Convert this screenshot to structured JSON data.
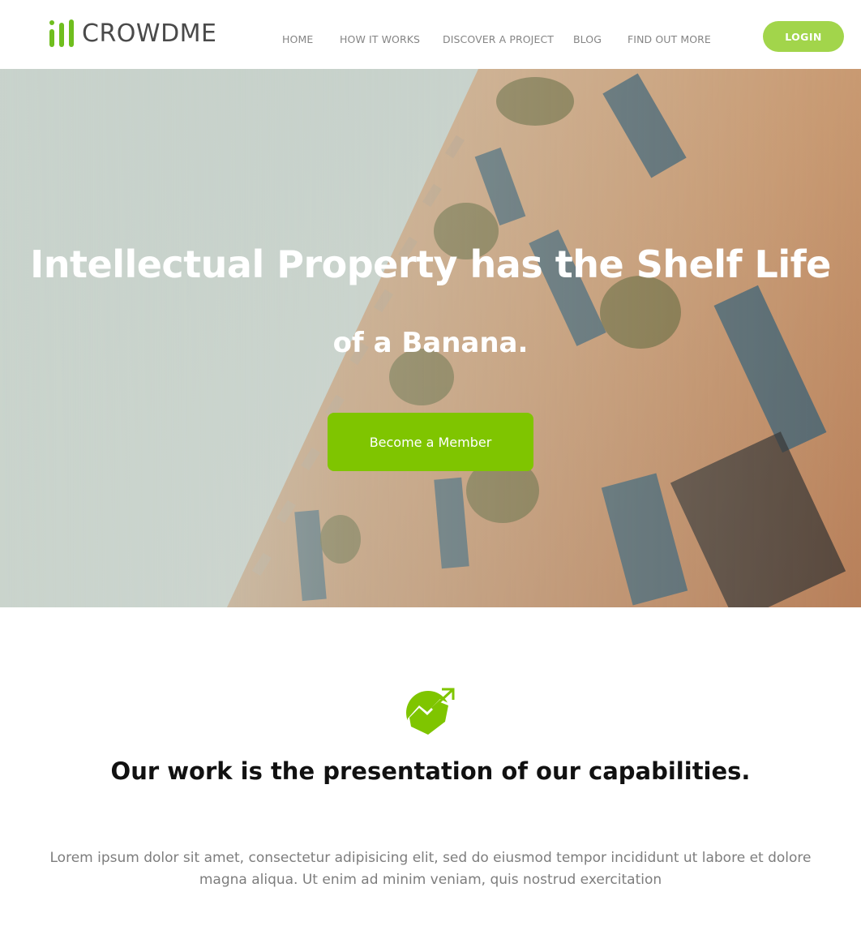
{
  "header": {
    "logo_text": "CROWDME",
    "nav": [
      {
        "label": "HOME"
      },
      {
        "label": "HOW IT WORKS"
      },
      {
        "label": "DISCOVER A PROJECT"
      },
      {
        "label": "BLOG"
      },
      {
        "label": "FIND OUT MORE"
      }
    ],
    "login_label": "LOGIN"
  },
  "hero": {
    "title": "Intellectual Property has the Shelf Life",
    "subtitle": "of a Banana.",
    "cta_label": "Become a Member"
  },
  "section": {
    "icon": "growth-chart-icon",
    "heading": "Our work is the presentation of our capabilities.",
    "body": "Lorem ipsum dolor sit amet, consectetur adipisicing elit, sed do eiusmod tempor incididunt ut labore et dolore magna aliqua. Ut enim ad minim veniam, quis nostrud exercitation"
  },
  "colors": {
    "brand_green": "#7fc500",
    "login_green": "#a2d54b",
    "logo_green": "#6fbe1e",
    "nav_text": "#858585"
  }
}
